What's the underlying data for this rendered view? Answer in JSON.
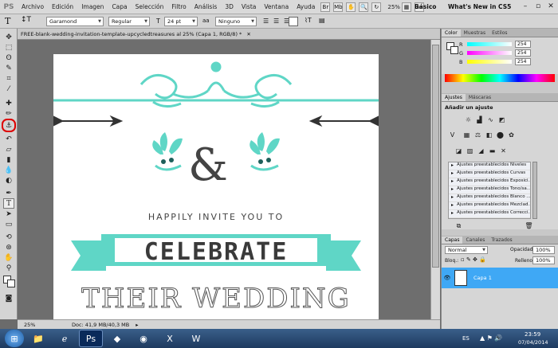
{
  "menubar": {
    "logo": "PS",
    "items": [
      "Archivo",
      "Edición",
      "Imagen",
      "Capa",
      "Selección",
      "Filtro",
      "Análisis",
      "3D",
      "Vista",
      "Ventana",
      "Ayuda"
    ],
    "zoom": "25%",
    "workspace": "Básico",
    "whats_new": "What's New in CS5"
  },
  "options": {
    "tool_glyph": "T",
    "font_family": "Garamond",
    "font_style": "Regular",
    "font_size": "24 pt",
    "antialias": "Ninguno"
  },
  "document": {
    "tab_title": "FREE-blank-wedding-invitation-template-upcycledtreasures al 25% (Capa 1, RGB/8) *",
    "text_invite": "HAPPILY INVITE YOU TO",
    "text_celebrate": "CELEBRATE",
    "text_wedding": "THEIR WEDDING",
    "ampersand": "&",
    "accent_color": "#5fd6c6"
  },
  "status": {
    "zoom": "25%",
    "doc_info": "Doc: 41,9 MB/40,3 MB"
  },
  "color_panel": {
    "tabs": [
      "Color",
      "Muestras",
      "Estilos"
    ],
    "rows": [
      {
        "label": "R",
        "value": "254",
        "gradient": "linear-gradient(90deg,#00ffff,#ffffff)"
      },
      {
        "label": "G",
        "value": "254",
        "gradient": "linear-gradient(90deg,#ff00ff,#ffffff)"
      },
      {
        "label": "B",
        "value": "254",
        "gradient": "linear-gradient(90deg,#ffff00,#ffffff)"
      }
    ]
  },
  "adjust_panel": {
    "tabs": [
      "Ajustes",
      "Máscaras"
    ],
    "title": "Añadir un ajuste",
    "presets": [
      "Ajustes preestablecidos Niveles",
      "Ajustes preestablecidos Curvas",
      "Ajustes preestablecidos Exposici...",
      "Ajustes preestablecidos Tono/sa...",
      "Ajustes preestablecidos Blanco ...",
      "Ajustes preestablecidos Mezclad...",
      "Ajustes preestablecidos Correcci..."
    ]
  },
  "layers_panel": {
    "tabs": [
      "Capas",
      "Canales",
      "Trazados"
    ],
    "blend_mode": "Normal",
    "opacity_label": "Opacidad:",
    "opacity": "100%",
    "lock_label": "Bloq.:",
    "fill_label": "Relleno:",
    "fill": "100%",
    "layer_name": "Capa 1"
  },
  "taskbar": {
    "lang": "ES",
    "time": "23:59",
    "date": "07/04/2014"
  }
}
